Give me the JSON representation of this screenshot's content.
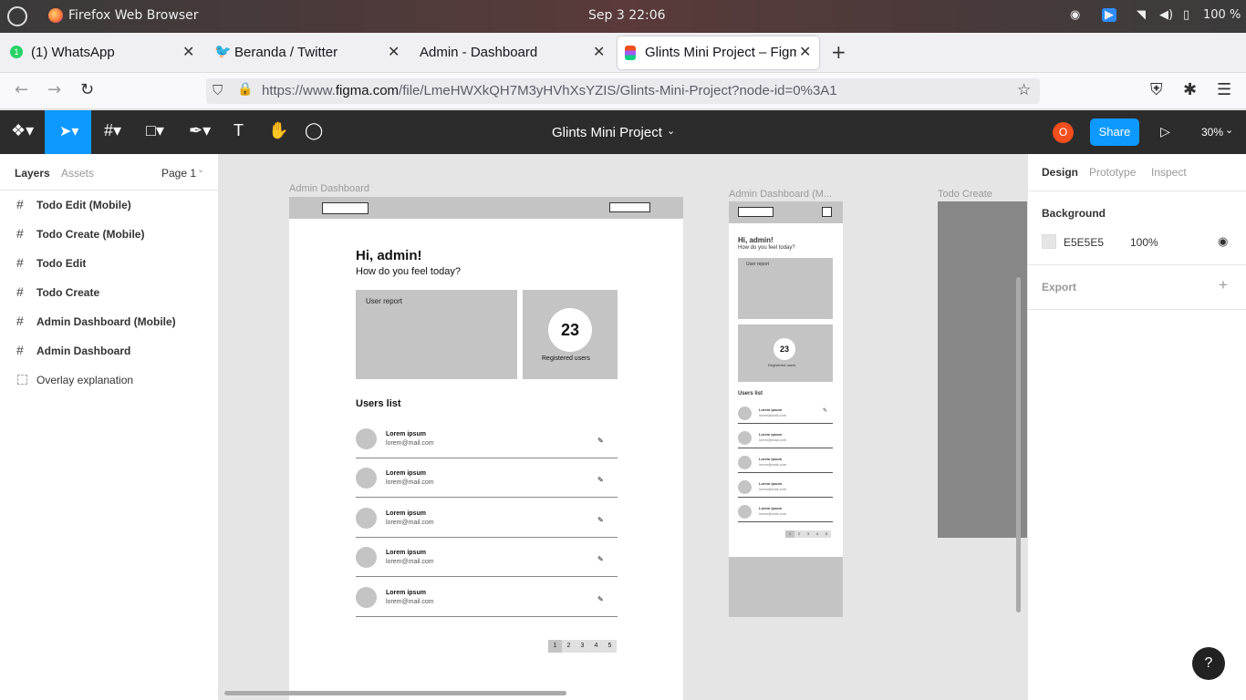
{
  "os": {
    "app_name": "Firefox Web Browser",
    "clock": "Sep 3  22:06",
    "battery": "100 %"
  },
  "tabs": [
    {
      "label": "(1) WhatsApp",
      "badge": "1"
    },
    {
      "label": "Beranda / Twitter"
    },
    {
      "label": "Admin - Dashboard"
    },
    {
      "label": "Glints Mini Project – Figma"
    }
  ],
  "nav": {
    "url_pre": "https://www.",
    "url_host": "figma.com",
    "url_rest": "/file/LmeHWXkQH7M3yHVhXsYZIS/Glints-Mini-Project?node-id=0%3A1"
  },
  "figma": {
    "file_title": "Glints Mini Project",
    "avatar_initial": "O",
    "share_label": "Share",
    "zoom": "30%"
  },
  "left": {
    "tab_layers": "Layers",
    "tab_assets": "Assets",
    "page": "Page 1",
    "layers": [
      {
        "name": "Todo Edit (Mobile)"
      },
      {
        "name": "Todo Create (Mobile)"
      },
      {
        "name": "Todo Edit"
      },
      {
        "name": "Todo Create"
      },
      {
        "name": "Admin Dashboard (Mobile)"
      },
      {
        "name": "Admin Dashboard"
      },
      {
        "name": "Overlay explanation"
      }
    ]
  },
  "canvas": {
    "frame1_label": "Admin Dashboard",
    "frame2_label": "Admin Dashboard (M...",
    "frame3_label": "Todo Create",
    "greeting": "Hi, admin!",
    "subgreeting": "How do you feel today?",
    "user_report": "User report",
    "registered_count": "23",
    "registered_label": "Registered users",
    "users_list": "Users list",
    "user_name": "Lorem ipsum",
    "user_email": "lorem@mail.com",
    "pages": [
      "1",
      "2",
      "3",
      "4",
      "5"
    ]
  },
  "right": {
    "tab_design": "Design",
    "tab_prototype": "Prototype",
    "tab_inspect": "Inspect",
    "background_title": "Background",
    "bg_hex": "E5E5E5",
    "bg_opacity": "100%",
    "export_title": "Export",
    "help": "?"
  }
}
